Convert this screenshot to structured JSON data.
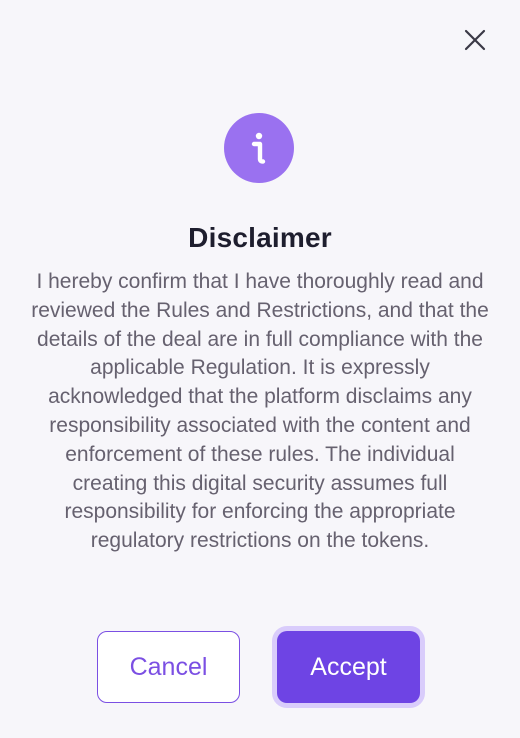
{
  "dialog": {
    "title": "Disclaimer",
    "body": "I hereby confirm that I have thoroughly read and reviewed the Rules and Restrictions, and that the details of the deal are in full compliance with the applicable Regulation. It is expressly acknowledged that the platform disclaims any responsibility associated with the content and enforcement of these rules. The individual creating this digital security assumes full responsibility for enforcing the appropriate regulatory restrictions on the tokens.",
    "cancel_label": "Cancel",
    "accept_label": "Accept",
    "icons": {
      "close": "close-icon",
      "info": "info-icon"
    },
    "colors": {
      "accent": "#6e44e4",
      "accent_light": "#9a71f0",
      "background": "#f7f6fa",
      "title": "#1e1e2e",
      "body": "#66616f"
    }
  }
}
